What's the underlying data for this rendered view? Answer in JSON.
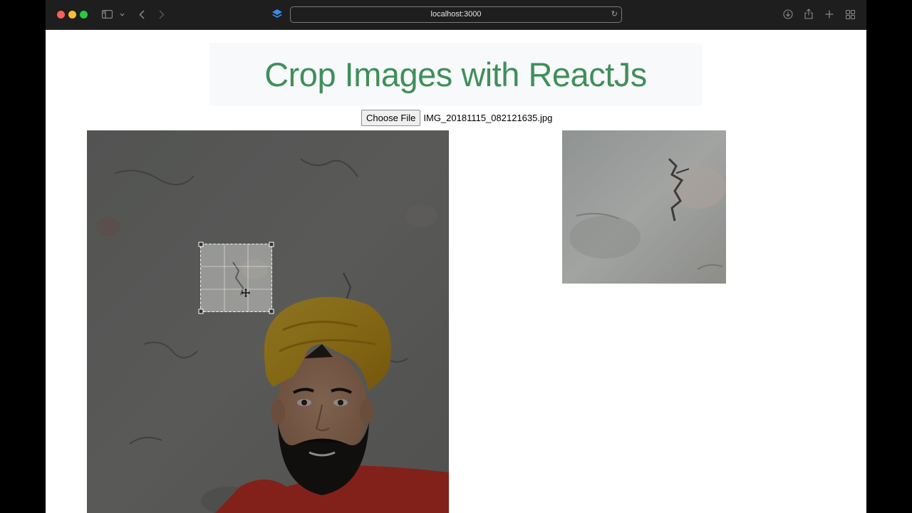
{
  "browser": {
    "url": "localhost:3000",
    "traffic_colors": [
      "#ff5f57",
      "#febc2e",
      "#28c840"
    ]
  },
  "page": {
    "title": "Crop Images with ReactJs",
    "title_color": "#3f8f5a",
    "file_input": {
      "button_label": "Choose File",
      "file_name": "IMG_20181115_082121635.jpg"
    }
  },
  "icons": {
    "sidebar": "sidebar-icon",
    "back": "chevron-left-icon",
    "forward": "chevron-right-icon",
    "extension": "layers-icon",
    "reload": "reload-icon",
    "download": "download-icon",
    "share": "share-icon",
    "new_tab": "plus-icon",
    "tab_overview": "grid-icon",
    "crop_move": "move-cursor-icon"
  }
}
